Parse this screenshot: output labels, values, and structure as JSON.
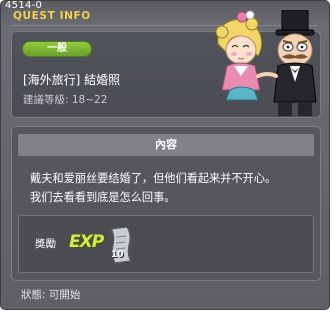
{
  "window": {
    "id_label": "4514-0",
    "title": "QUEST INFO"
  },
  "quest": {
    "category_badge": "一般",
    "name": "[海外旅行] 結婚照",
    "level_text": "建議等級: 18~22"
  },
  "content": {
    "header": "內容",
    "lines": [
      "戴夫和爱丽丝要结婚了，但他们看起来并不开心。",
      "我们去看看到底是怎么回事。"
    ]
  },
  "reward": {
    "label": "獎勵",
    "exp_text": "EXP",
    "item_icon": "scroll-icon",
    "item_count": "10"
  },
  "status": {
    "text": "狀態:  可開始"
  },
  "colors": {
    "title": "#f2d24a",
    "badge": "#7db634",
    "panel": "#55575d"
  }
}
